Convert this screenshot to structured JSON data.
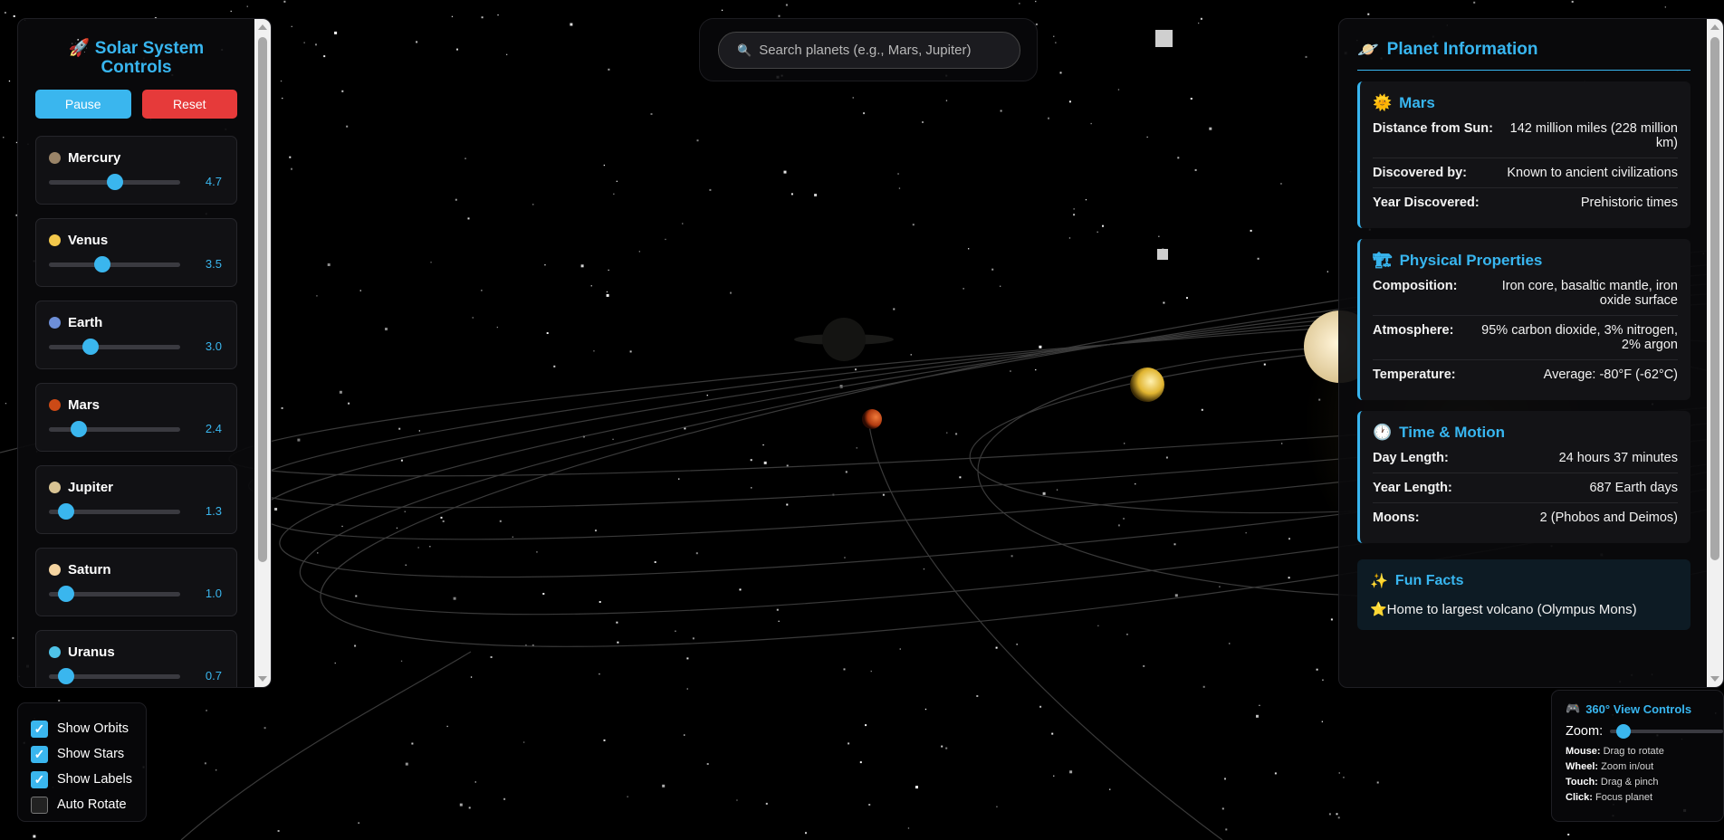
{
  "controls": {
    "title": "Solar System Controls",
    "title_icon": "rocket-icon",
    "pause_label": "Pause",
    "reset_label": "Reset",
    "planets": [
      {
        "name": "Mercury",
        "color": "#9a8468",
        "speed": "4.7",
        "level": 0.5
      },
      {
        "name": "Venus",
        "color": "#f3c84b",
        "speed": "3.5",
        "level": 0.41
      },
      {
        "name": "Earth",
        "color": "#6d8fd8",
        "speed": "3.0",
        "level": 0.32
      },
      {
        "name": "Mars",
        "color": "#cc4a16",
        "speed": "2.4",
        "level": 0.23
      },
      {
        "name": "Jupiter",
        "color": "#d8c393",
        "speed": "1.3",
        "level": 0.13
      },
      {
        "name": "Saturn",
        "color": "#f5d4a0",
        "speed": "1.0",
        "level": 0.13
      },
      {
        "name": "Uranus",
        "color": "#4fc3e8",
        "speed": "0.7",
        "level": 0.13
      }
    ]
  },
  "search": {
    "placeholder": "Search planets (e.g., Mars, Jupiter)",
    "icon": "magnifier-icon"
  },
  "info": {
    "title": "Planet Information",
    "planet": {
      "name": "Mars",
      "rows": [
        {
          "label": "Distance from Sun:",
          "value": "142 million miles (228 million km)"
        },
        {
          "label": "Discovered by:",
          "value": "Known to ancient civilizations"
        },
        {
          "label": "Year Discovered:",
          "value": "Prehistoric times"
        }
      ]
    },
    "physical": {
      "title": "Physical Properties",
      "rows": [
        {
          "label": "Composition:",
          "value": "Iron core, basaltic mantle, iron oxide surface"
        },
        {
          "label": "Atmosphere:",
          "value": "95% carbon dioxide, 3% nitrogen, 2% argon"
        },
        {
          "label": "Temperature:",
          "value": "Average: -80°F (-62°C)"
        }
      ]
    },
    "time": {
      "title": "Time & Motion",
      "rows": [
        {
          "label": "Day Length:",
          "value": "24 hours 37 minutes"
        },
        {
          "label": "Year Length:",
          "value": "687 Earth days"
        },
        {
          "label": "Moons:",
          "value": "2 (Phobos and Deimos)"
        }
      ]
    },
    "fun": {
      "title": "Fun Facts",
      "items": [
        "⭐Home to largest volcano (Olympus Mons)"
      ]
    }
  },
  "toggles": [
    {
      "label": "Show Orbits",
      "checked": true
    },
    {
      "label": "Show Stars",
      "checked": true
    },
    {
      "label": "Show Labels",
      "checked": true
    },
    {
      "label": "Auto Rotate",
      "checked": false
    }
  ],
  "view": {
    "title": "360° View Controls",
    "zoom_label": "Zoom:",
    "zoom_level": 0.05,
    "help": [
      {
        "key": "Mouse:",
        "text": "Drag to rotate"
      },
      {
        "key": "Wheel:",
        "text": "Zoom in/out"
      },
      {
        "key": "Touch:",
        "text": "Drag & pinch"
      },
      {
        "key": "Click:",
        "text": "Focus planet"
      }
    ]
  },
  "colors": {
    "accent": "#38b6f0",
    "reset": "#e63a3a",
    "background": "#000000"
  }
}
